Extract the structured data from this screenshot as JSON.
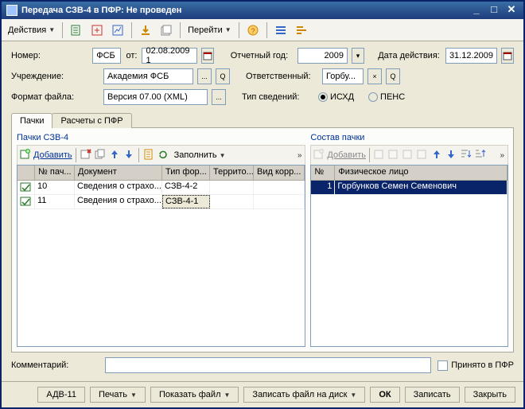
{
  "window": {
    "title": "Передача СЗВ-4 в ПФР: Не проведен"
  },
  "menu": {
    "actions": "Действия",
    "navigate": "Перейти"
  },
  "form": {
    "number_label": "Номер:",
    "number_value": "ФСБ",
    "from_label": "от:",
    "date_value": "02.08.2009 1",
    "report_year_label": "Отчетный год:",
    "report_year_value": "2009",
    "action_date_label": "Дата действия:",
    "action_date_value": "31.12.2009",
    "org_label": "Учреждение:",
    "org_value": "Академия ФСБ",
    "responsible_label": "Ответственный:",
    "responsible_value": "Горбу...",
    "format_label": "Формат файла:",
    "format_value": "Версия 07.00 (XML)",
    "type_label": "Тип сведений:",
    "radio_out": "ИСХД",
    "radio_pens": "ПЕНС"
  },
  "tabs": {
    "packs": "Пачки",
    "calc": "Расчеты с ПФР"
  },
  "left": {
    "title": "Пачки СЗВ-4",
    "add": "Добавить",
    "fill": "Заполнить",
    "cols": {
      "num": "№ пач...",
      "doc": "Документ",
      "type": "Тип фор...",
      "terr": "Террито...",
      "corr": "Вид корр..."
    },
    "rows": [
      {
        "num": "10",
        "doc": "Сведения о страхо...",
        "type": "СЗВ-4-2",
        "terr": "",
        "corr": ""
      },
      {
        "num": "11",
        "doc": "Сведения о страхо...",
        "type": "СЗВ-4-1",
        "terr": "",
        "corr": ""
      }
    ]
  },
  "right": {
    "title": "Состав пачки",
    "add": "Добавить",
    "cols": {
      "num": "№",
      "person": "Физическое лицо"
    },
    "rows": [
      {
        "num": "1",
        "person": "Горбунков Семен Семенович"
      }
    ]
  },
  "bottom": {
    "comment_label": "Комментарий:",
    "accepted_label": "Принято в ПФР"
  },
  "footer": {
    "adv": "АДВ-11",
    "print": "Печать",
    "show": "Показать файл",
    "write": "Записать файл на диск",
    "ok": "ОК",
    "save": "Записать",
    "close": "Закрыть"
  }
}
